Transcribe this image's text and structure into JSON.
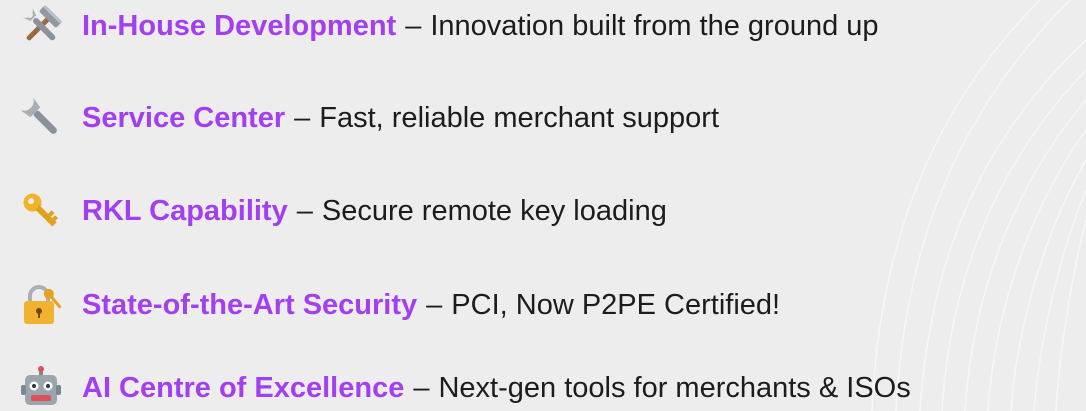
{
  "features": [
    {
      "icon": "hammer-and-wrench-icon",
      "title": "In-House Development",
      "separator": "–",
      "description": "Innovation built from the ground up"
    },
    {
      "icon": "wrench-icon",
      "title": "Service Center",
      "separator": "–",
      "description": "Fast, reliable merchant support"
    },
    {
      "icon": "key-icon",
      "title": "RKL Capability",
      "separator": "–",
      "description": "Secure remote key loading"
    },
    {
      "icon": "locked-with-key-icon",
      "title": "State-of-the-Art Security",
      "separator": "–",
      "description": "PCI, Now P2PE Certified!"
    },
    {
      "icon": "robot-icon",
      "title": "AI Centre of Excellence",
      "separator": "–",
      "description": "Next-gen tools for merchants & ISOs"
    }
  ],
  "colors": {
    "background": "#ededed",
    "title_accent": "#a23ff0",
    "text": "#1c1c1c"
  }
}
